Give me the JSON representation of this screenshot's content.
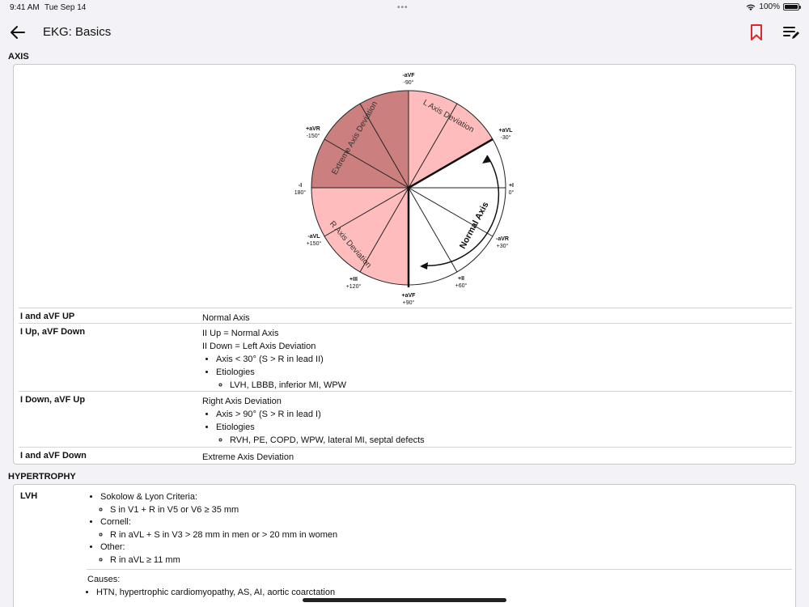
{
  "status": {
    "time": "9:41 AM",
    "date": "Tue Sep 14",
    "battery": "100%",
    "battery_level": 1.0
  },
  "nav": {
    "title": "EKG: Basics"
  },
  "colors": {
    "accent": "#e0262b",
    "axis_dark": "#cc7f7f",
    "axis_light": "#ffbcbc"
  },
  "axis_section": {
    "header": "AXIS",
    "diagram": {
      "sectors": [
        "Extreme Axis Deviation",
        "L Axis Deviation",
        "R Axis Deviation",
        "Normal Axis"
      ],
      "leads": [
        {
          "name": "-aVF",
          "angle": "-90°"
        },
        {
          "name": "+aVL",
          "angle": "-30°"
        },
        {
          "name": "+I",
          "angle": "0°"
        },
        {
          "name": "-aVR",
          "angle": "+30°"
        },
        {
          "name": "+II",
          "angle": "+60°"
        },
        {
          "name": "+aVF",
          "angle": "+90°"
        },
        {
          "name": "+III",
          "angle": "+120°"
        },
        {
          "name": "-aVL",
          "angle": "+150°"
        },
        {
          "name": "-I",
          "angle": "180°"
        },
        {
          "name": "+aVR",
          "angle": "-150°"
        }
      ]
    },
    "rows": [
      {
        "label": "I and aVF UP",
        "line1": "Normal Axis"
      },
      {
        "label": "I Up, aVF Down",
        "line1": "II Up = Normal Axis",
        "line2": "II Down = Left Axis Deviation",
        "b1": "Axis < 30° (S > R in lead II)",
        "b2": "Etiologies",
        "sub1": "LVH, LBBB, inferior MI, WPW"
      },
      {
        "label": "I Down, aVF Up",
        "line1": "Right Axis Deviation",
        "b1": "Axis > 90° (S > R in lead I)",
        "b2": "Etiologies",
        "sub1": "RVH, PE, COPD, WPW, lateral MI, septal defects"
      },
      {
        "label": "I and aVF Down",
        "line1": "Extreme Axis Deviation"
      }
    ]
  },
  "hypertrophy_section": {
    "header": "HYPERTROPHY",
    "lvh": {
      "label": "LVH",
      "c1": "Sokolow & Lyon Criteria:",
      "c1s": "S in V1 + R in V5 or V6 ≥ 35 mm",
      "c2": "Cornell:",
      "c2s": "R in aVL + S in V3 > 28 mm in men or > 20 mm in women",
      "c3": "Other:",
      "c3s": "R in aVL ≥ 11 mm",
      "causes_label": "Causes:",
      "cause1": "HTN, hypertrophic cardiomyopathy, AS, AI, aortic coarctation"
    }
  }
}
